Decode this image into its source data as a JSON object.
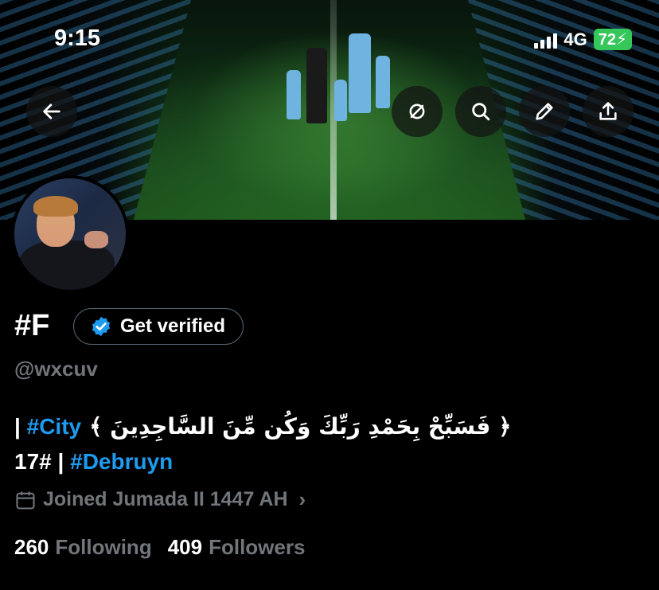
{
  "status_bar": {
    "time": "9:15",
    "network": "4G",
    "battery": "72"
  },
  "header": {
    "icons": [
      "arrow-left-icon",
      "grok-icon",
      "search-icon",
      "pencil-icon",
      "share-icon"
    ]
  },
  "profile": {
    "display_name": "#F",
    "get_verified_label": "Get verified",
    "handle": "@wxcuv",
    "bio": {
      "prefix": "|",
      "tag_city": "#City",
      "arabic": "﴿ فَسَبِّحْ بِحَمْدِ رَبِّكَ وَكُن مِّنَ السَّاجِدِينَ ﴾",
      "number": "17#",
      "separator": "|",
      "tag_debruyn": "#Debruyn"
    },
    "joined": "Joined Jumada II 1447 AH",
    "following_count": "260",
    "following_label": "Following",
    "followers_count": "409",
    "followers_label": "Followers"
  },
  "colors": {
    "background": "#000000",
    "accent": "#1d9bf0",
    "muted": "#71767b",
    "battery": "#35c759"
  }
}
